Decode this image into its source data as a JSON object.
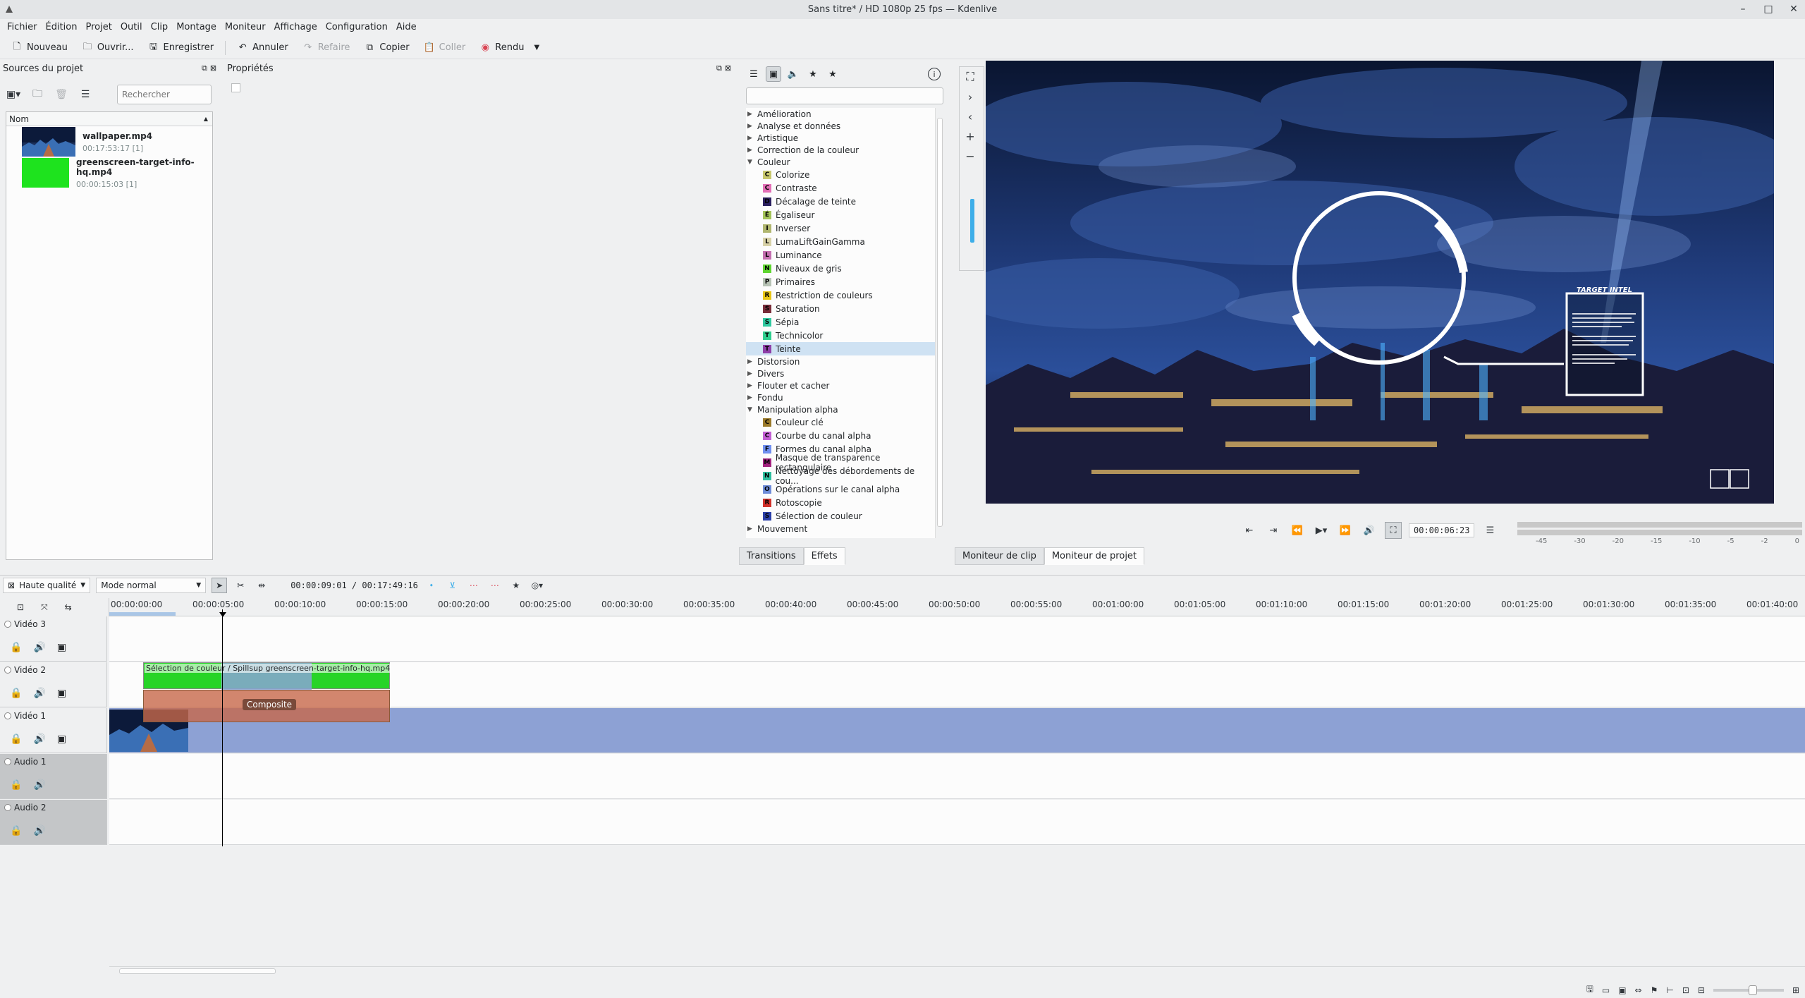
{
  "window": {
    "title": "Sans titre* / HD 1080p 25 fps — Kdenlive"
  },
  "menu": [
    "Fichier",
    "Édition",
    "Projet",
    "Outil",
    "Clip",
    "Montage",
    "Moniteur",
    "Affichage",
    "Configuration",
    "Aide"
  ],
  "toolbar": {
    "new": "Nouveau",
    "open": "Ouvrir...",
    "save": "Enregistrer",
    "undo": "Annuler",
    "redo": "Refaire",
    "copy": "Copier",
    "paste": "Coller",
    "render": "Rendu"
  },
  "project_bin": {
    "title": "Sources du projet",
    "search_placeholder": "Rechercher",
    "column": "Nom",
    "clips": [
      {
        "name": "wallpaper.mp4",
        "meta": "00:17:53:17  [1]"
      },
      {
        "name": "greenscreen-target-info-hq.mp4",
        "meta": "00:00:15:03  [1]"
      }
    ]
  },
  "properties": {
    "title": "Propriétés"
  },
  "effects": {
    "tree": [
      {
        "type": "cat",
        "label": "Amélioration",
        "open": false
      },
      {
        "type": "cat",
        "label": "Analyse et données",
        "open": false
      },
      {
        "type": "cat",
        "label": "Artistique",
        "open": false
      },
      {
        "type": "cat",
        "label": "Correction de la couleur",
        "open": false
      },
      {
        "type": "cat",
        "label": "Couleur",
        "open": true
      },
      {
        "type": "item",
        "label": "Colorize",
        "letter": "C",
        "color": "#c8c86e"
      },
      {
        "type": "item",
        "label": "Contraste",
        "letter": "C",
        "color": "#e36fb6"
      },
      {
        "type": "item",
        "label": "Décalage de teinte",
        "letter": "D",
        "color": "#2a1f5e"
      },
      {
        "type": "item",
        "label": "Égaliseur",
        "letter": "É",
        "color": "#a4c45a"
      },
      {
        "type": "item",
        "label": "Inverser",
        "letter": "I",
        "color": "#b0b66f"
      },
      {
        "type": "item",
        "label": "LumaLiftGainGamma",
        "letter": "L",
        "color": "#d8d2a8"
      },
      {
        "type": "item",
        "label": "Luminance",
        "letter": "L",
        "color": "#c46fb0"
      },
      {
        "type": "item",
        "label": "Niveaux de gris",
        "letter": "N",
        "color": "#5fd630"
      },
      {
        "type": "item",
        "label": "Primaires",
        "letter": "P",
        "color": "#b7c3b5"
      },
      {
        "type": "item",
        "label": "Restriction de couleurs",
        "letter": "R",
        "color": "#e8c617"
      },
      {
        "type": "item",
        "label": "Saturation",
        "letter": "S",
        "color": "#7a2d3a"
      },
      {
        "type": "item",
        "label": "Sépia",
        "letter": "S",
        "color": "#30c9a0"
      },
      {
        "type": "item",
        "label": "Technicolor",
        "letter": "T",
        "color": "#2fcf8f"
      },
      {
        "type": "item",
        "label": "Teinte",
        "letter": "T",
        "color": "#8e3fa8",
        "selected": true
      },
      {
        "type": "cat",
        "label": "Distorsion",
        "open": false
      },
      {
        "type": "cat",
        "label": "Divers",
        "open": false
      },
      {
        "type": "cat",
        "label": "Flouter et cacher",
        "open": false
      },
      {
        "type": "cat",
        "label": "Fondu",
        "open": false
      },
      {
        "type": "cat",
        "label": "Manipulation alpha",
        "open": true
      },
      {
        "type": "item",
        "label": "Couleur clé",
        "letter": "C",
        "color": "#9a7a2a"
      },
      {
        "type": "item",
        "label": "Courbe du canal alpha",
        "letter": "C",
        "color": "#c25fd3"
      },
      {
        "type": "item",
        "label": "Formes du canal alpha",
        "letter": "F",
        "color": "#6f8ff0"
      },
      {
        "type": "item",
        "label": "Masque de transparence rectangulaire",
        "letter": "M",
        "color": "#a2237e"
      },
      {
        "type": "item",
        "label": "Nettoyage des débordements de cou...",
        "letter": "N",
        "color": "#2fbf9f"
      },
      {
        "type": "item",
        "label": "Opérations sur le canal alpha",
        "letter": "O",
        "color": "#6f8cd8"
      },
      {
        "type": "item",
        "label": "Rotoscopie",
        "letter": "R",
        "color": "#d0302a"
      },
      {
        "type": "item",
        "label": "Sélection de couleur",
        "letter": "S",
        "color": "#2a3fa8"
      },
      {
        "type": "cat",
        "label": "Mouvement",
        "open": false
      }
    ],
    "tabs": [
      "Transitions",
      "Effets"
    ]
  },
  "monitor": {
    "timecode": "00:00:06:23",
    "tabs": [
      "Moniteur de clip",
      "Moniteur de projet"
    ],
    "overlay_title": "TARGET INTEL",
    "vu_scale": [
      "-45",
      "-30",
      "-20",
      "-15",
      "-10",
      "-5",
      "-2",
      "0"
    ]
  },
  "timeline": {
    "quality": "Haute qualité",
    "mode": "Mode normal",
    "position": "00:00:09:01 / 00:17:49:16",
    "ruler": [
      "00:00:00:00",
      "00:00:05:00",
      "00:00:10:00",
      "00:00:15:00",
      "00:00:20:00",
      "00:00:25:00",
      "00:00:30:00",
      "00:00:35:00",
      "00:00:40:00",
      "00:00:45:00",
      "00:00:50:00",
      "00:00:55:00",
      "00:01:00:00",
      "00:01:05:00",
      "00:01:10:00",
      "00:01:15:00",
      "00:01:20:00",
      "00:01:25:00",
      "00:01:30:00",
      "00:01:35:00",
      "00:01:40:00"
    ],
    "tracks": [
      {
        "name": "Vidéo 3",
        "kind": "video"
      },
      {
        "name": "Vidéo 2",
        "kind": "video"
      },
      {
        "name": "Vidéo 1",
        "kind": "video"
      },
      {
        "name": "Audio 1",
        "kind": "audio"
      },
      {
        "name": "Audio 2",
        "kind": "audio"
      }
    ],
    "clip_v2_label": "Sélection de couleur / Spillsup greenscreen-target-info-hq.mp4",
    "composite_label": "Composite"
  }
}
